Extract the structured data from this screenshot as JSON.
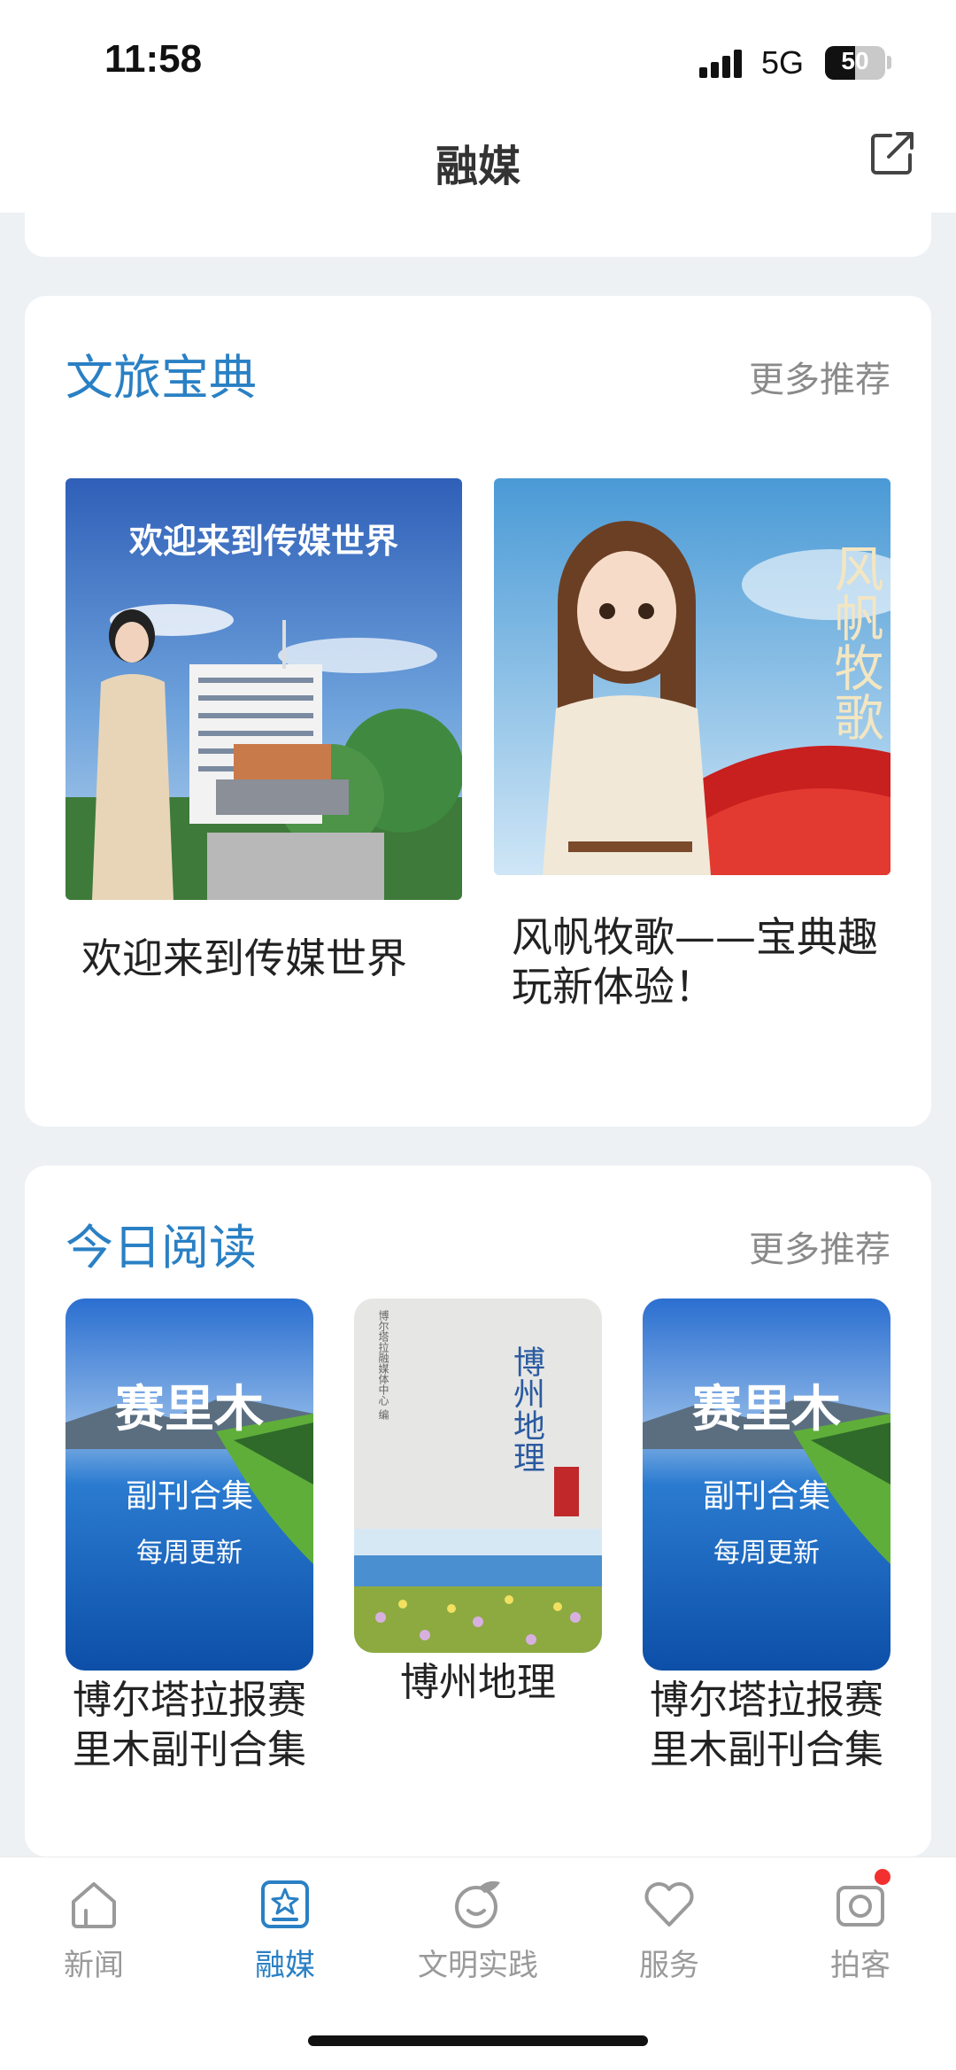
{
  "status_bar": {
    "time": "11:58",
    "network": "5G",
    "battery": "50",
    "battery_level": 0.5
  },
  "header": {
    "title": "融媒"
  },
  "culture_section": {
    "title": "文旅宝典",
    "more": "更多推荐",
    "items": [
      {
        "caption": "欢迎来到传媒世界",
        "overlay": "欢迎来到传媒世界"
      },
      {
        "caption": "风帆牧歌——宝典趣玩新体验！",
        "overlay": "风帆牧歌"
      }
    ]
  },
  "reading_section": {
    "title": "今日阅读",
    "more": "更多推荐",
    "books": [
      {
        "caption": "博尔塔拉报赛里木副刊合集",
        "cover_title": "赛里木",
        "cover_sub": "副刊合集",
        "cover_note": "每周更新"
      },
      {
        "caption": "博州地理",
        "cover_title": "博州地理",
        "cover_side": "博尔塔拉融媒体中心 编"
      },
      {
        "caption": "博尔塔拉报赛里木副刊合集",
        "cover_title": "赛里木",
        "cover_sub": "副刊合集",
        "cover_note": "每周更新"
      }
    ]
  },
  "nav": {
    "items": [
      {
        "label": "新闻",
        "icon": "home-icon"
      },
      {
        "label": "融媒",
        "icon": "media-icon",
        "active": true
      },
      {
        "label": "文明实践",
        "icon": "civilization-icon"
      },
      {
        "label": "服务",
        "icon": "heart-icon"
      },
      {
        "label": "拍客",
        "icon": "camera-icon"
      }
    ]
  },
  "colors": {
    "accent": "#2a80c4",
    "inactive": "#9a9a9a",
    "badge": "#f23030"
  }
}
